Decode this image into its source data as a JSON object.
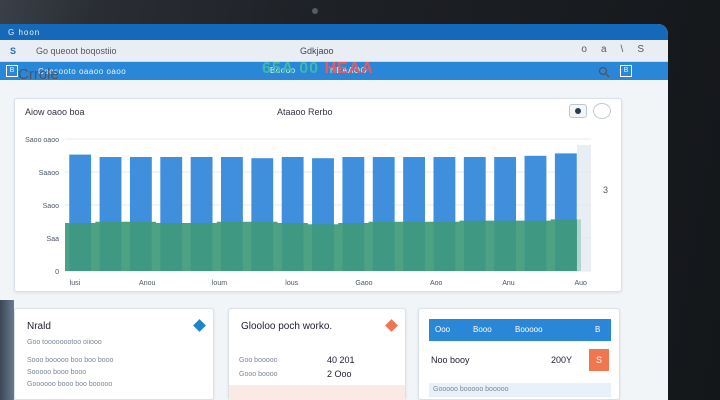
{
  "device": {
    "app_name": "G hoon"
  },
  "titlebar": {
    "brand": "G hoon"
  },
  "toolbar": {
    "s_label": "S",
    "url": "Go queoot boqostiio",
    "center_title": "Gdkjaoo",
    "icons": [
      "o",
      "a",
      "\\",
      "S"
    ]
  },
  "navbar": {
    "box_label": "B",
    "title": "Coosooto oaaoo oaoo",
    "tab1": "Boooo",
    "tab2": "NEAAOO",
    "end_label": "B"
  },
  "page": {
    "title": "Crrole",
    "code_part1": "65A",
    "code_part2": "00 ",
    "code_part3": "HEAA",
    "search_icon": "search-icon"
  },
  "chart_card": {
    "title": "Aiow oaoo boa",
    "subtitle": "Ataaoo Rerbo",
    "side_value": "3",
    "colors": {
      "bar": "#3f8fdc",
      "area": "#3f9a7a"
    }
  },
  "chart_data": {
    "type": "bar",
    "categories": [
      "",
      "",
      "",
      "",
      "",
      "",
      "",
      "",
      "",
      "",
      "",
      "",
      "",
      "",
      "",
      "",
      ""
    ],
    "series": [
      {
        "values": [
          97,
          95,
          95,
          95,
          95,
          95,
          94,
          95,
          94,
          95,
          95,
          95,
          95,
          95,
          95,
          96,
          98
        ]
      },
      {
        "values": [
          40,
          41,
          41,
          40,
          40,
          41,
          41,
          40,
          39,
          40,
          41,
          41,
          41,
          42,
          42,
          42,
          43
        ]
      }
    ],
    "tick_labels_y": [
      "Saoo oaoo",
      "Saaoo",
      "Saoo",
      "Saa",
      "0"
    ],
    "tick_labels_x": [
      "lusi",
      "Anou",
      "loum",
      "lous",
      "Gaoo",
      "Aoo",
      "Anu",
      "Auo"
    ],
    "ylim": [
      0,
      110
    ]
  },
  "cards": {
    "c1": {
      "title": "Nrald",
      "line1": "Goo toooooootoo oiiooo",
      "line2": "Sooo booooo boo boo booo",
      "line3": "Sooooo booo booo",
      "line4": "Goooooo booo boo booooo",
      "dia_color": "#1e86c8"
    },
    "c2": {
      "title": "Glooloo poch worko.",
      "row1_label": "Goo booooo",
      "row1_value": "40 201",
      "row2_label": "Gooo boooo",
      "row2_value": "2 Ooo",
      "row3_label": "",
      "row3_value": "",
      "dia_color": "#f0764f"
    },
    "c3": {
      "h1": "Ooo",
      "h2": "Booo",
      "h3": "Booooo",
      "h4": "B",
      "label": "Noo booy",
      "value": "200Y",
      "badge": "S",
      "line1": "Gooooo booooo booooo"
    }
  }
}
